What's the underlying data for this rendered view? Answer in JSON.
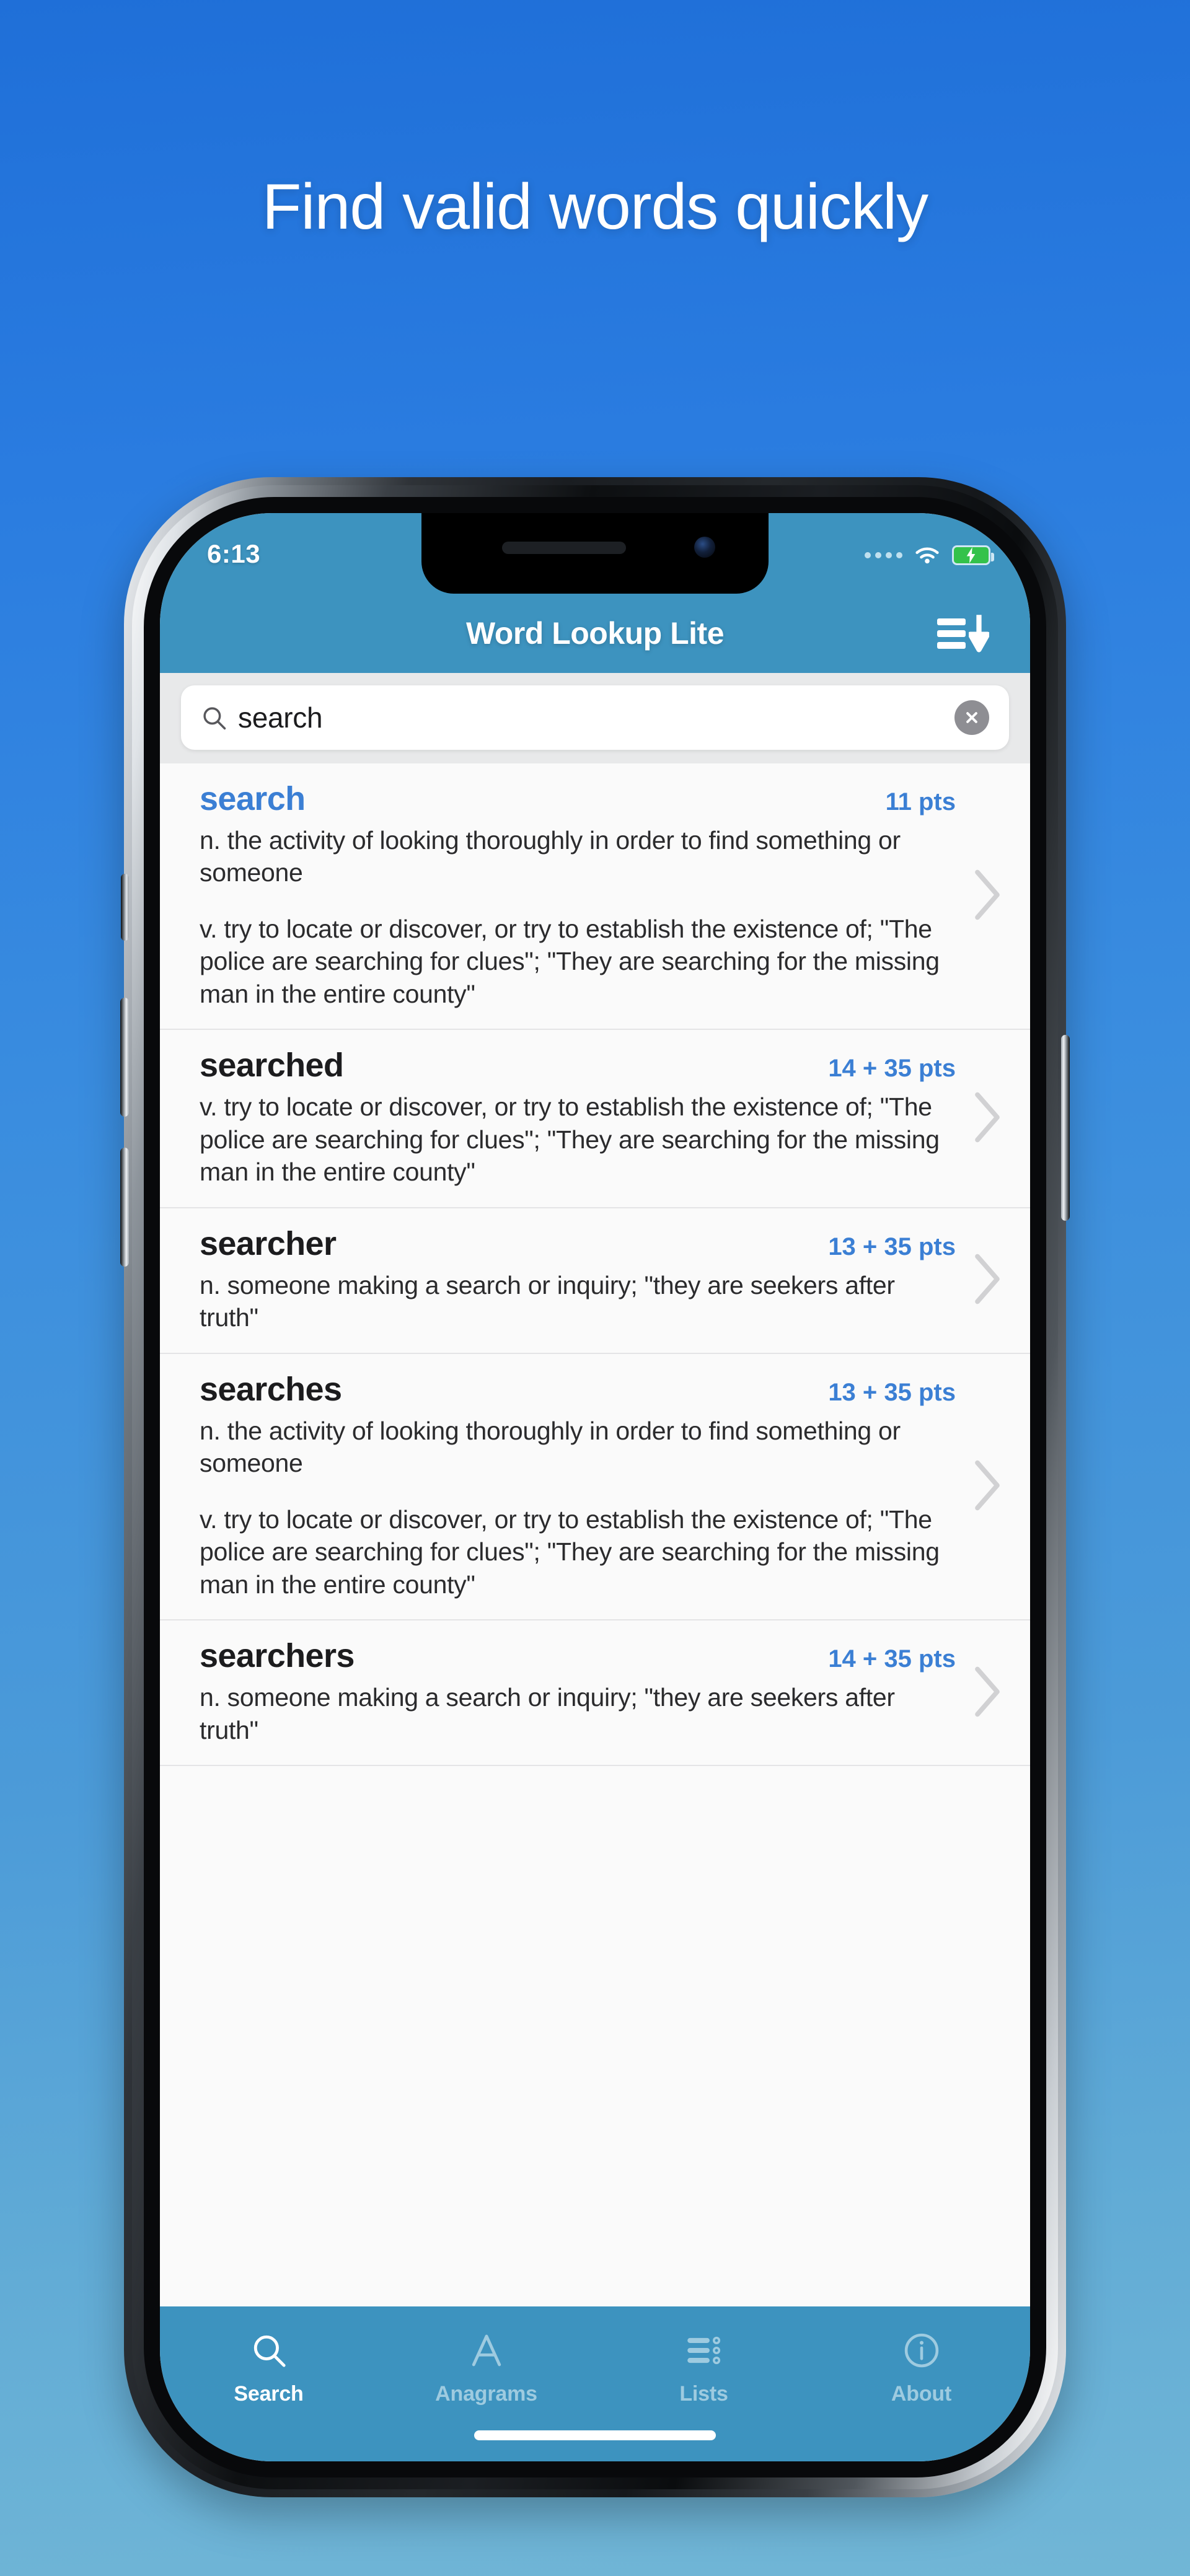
{
  "promo": {
    "headline": "Find valid words quickly",
    "background_top": "#1f6fd8",
    "background_bottom": "#71b6d6"
  },
  "statusbar": {
    "time": "6:13",
    "wifi_icon": "wifi-icon",
    "battery_icon": "battery-charging-icon",
    "signal_icon": "signal-dots-icon"
  },
  "navbar": {
    "title": "Word Lookup Lite",
    "sort_icon": "sort-descending-icon",
    "background": "#3d93bf"
  },
  "search": {
    "value": "search",
    "placeholder": "search",
    "search_icon": "search-icon",
    "clear_icon": "clear-circle-icon"
  },
  "results": [
    {
      "word": "search",
      "highlighted": true,
      "points": "11 pts",
      "definitions": [
        "n. the activity of looking thoroughly in order to find something or someone",
        "v. try to locate or discover, or try to establish the existence of; \"The police are searching for clues\"; \"They are searching for the missing man in the entire county\""
      ]
    },
    {
      "word": "searched",
      "highlighted": false,
      "points": "14 + 35 pts",
      "definitions": [
        "v. try to locate or discover, or try to establish the existence of; \"The police are searching for clues\"; \"They are searching for the missing man in the entire county\""
      ]
    },
    {
      "word": "searcher",
      "highlighted": false,
      "points": "13 + 35 pts",
      "definitions": [
        "n. someone making a search or inquiry; \"they are seekers after truth\""
      ]
    },
    {
      "word": "searches",
      "highlighted": false,
      "points": "13 + 35 pts",
      "definitions": [
        "n. the activity of looking thoroughly in order to find something or someone",
        "v. try to locate or discover, or try to establish the existence of; \"The police are searching for clues\"; \"They are searching for the missing man in the entire county\""
      ]
    },
    {
      "word": "searchers",
      "highlighted": false,
      "points": "14 + 35 pts",
      "definitions": [
        "n. someone making a search or inquiry; \"they are seekers after truth\""
      ]
    }
  ],
  "tabs": [
    {
      "label": "Search",
      "icon": "magnifier-icon",
      "active": true
    },
    {
      "label": "Anagrams",
      "icon": "letter-a-icon",
      "active": false
    },
    {
      "label": "Lists",
      "icon": "list-icon",
      "active": false
    },
    {
      "label": "About",
      "icon": "info-icon",
      "active": false
    }
  ]
}
